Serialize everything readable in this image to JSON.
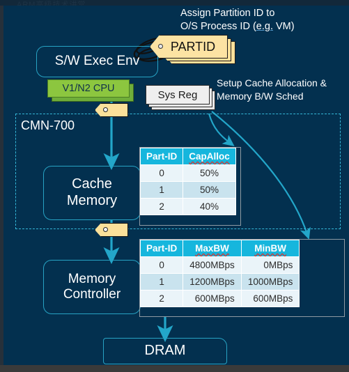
{
  "slide": {
    "background_color": "#03304f",
    "ghost_top_text": "ARM高级技术讲堂"
  },
  "callouts": {
    "assign": {
      "line1": "Assign Partition ID to",
      "line2_a": "O/S Process ID (",
      "line2_b": "e.g.",
      "line2_c": " VM)"
    },
    "setup": {
      "line1": "Setup Cache Allocation &",
      "line2": "Memory B/W Sched"
    }
  },
  "blocks": {
    "sw_exec_env": "S/W Exec Env",
    "cpu": "V1/N2 CPU",
    "sys_reg": "Sys Reg",
    "partid": "PARTID",
    "cmn_region": "CMN-700",
    "cache_memory": "Cache\nMemory",
    "cache_memory_line1": "Cache",
    "cache_memory_line2": "Memory",
    "memory_controller_line1": "Memory",
    "memory_controller_line2": "Controller",
    "dram": "DRAM"
  },
  "tables": {
    "cache_alloc": {
      "headers": [
        "Part-ID",
        "CapAlloc"
      ],
      "rows": [
        [
          "0",
          "50%"
        ],
        [
          "1",
          "50%"
        ],
        [
          "2",
          "40%"
        ]
      ]
    },
    "bandwidth": {
      "headers": [
        "Part-ID",
        "MaxBW",
        "MinBW"
      ],
      "rows": [
        [
          "0",
          "4800MBps",
          "0MBps"
        ],
        [
          "1",
          "1200MBps",
          "1000MBps"
        ],
        [
          "2",
          "600MBps",
          "600MBps"
        ]
      ]
    }
  },
  "colors": {
    "background": "#03304f",
    "accent_cyan": "#27a3c4",
    "table_header": "#16b6dd",
    "cpu_green": "#8cc63f",
    "tag_yellow": "#fbe09a",
    "dashed_border": "#35b7d8",
    "text_white": "#ffffff"
  }
}
